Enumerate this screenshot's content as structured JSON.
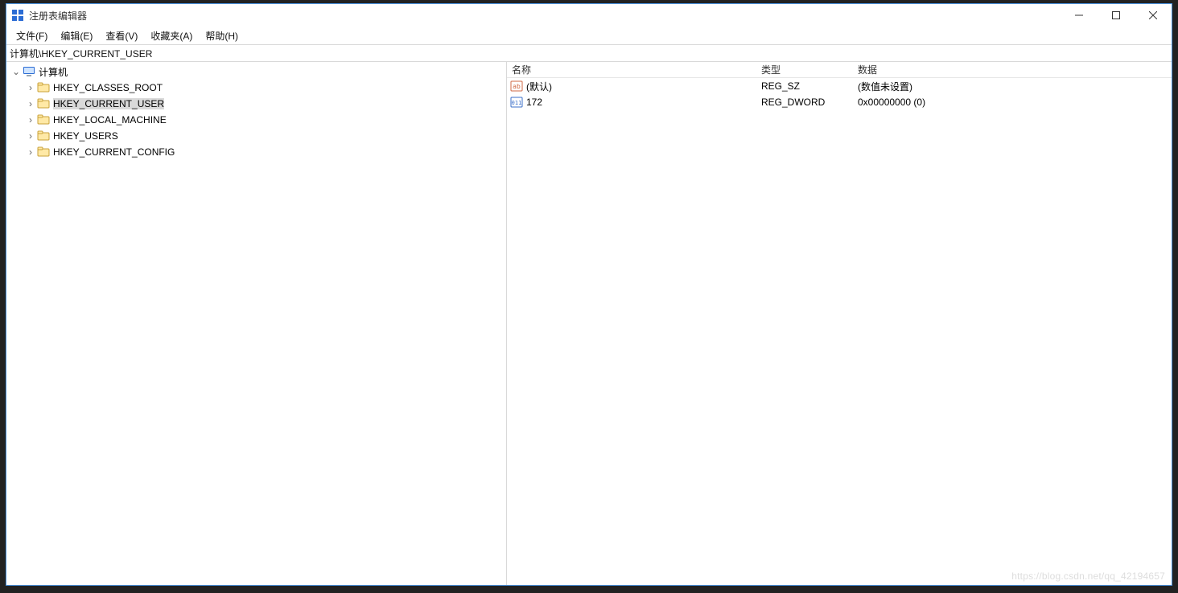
{
  "window": {
    "title": "注册表编辑器"
  },
  "menu": {
    "file": "文件(F)",
    "edit": "编辑(E)",
    "view": "查看(V)",
    "favorites": "收藏夹(A)",
    "help": "帮助(H)"
  },
  "address": {
    "path": "计算机\\HKEY_CURRENT_USER"
  },
  "tree": {
    "root": "计算机",
    "root_selected": false,
    "keys": [
      {
        "name": "HKEY_CLASSES_ROOT",
        "selected": false
      },
      {
        "name": "HKEY_CURRENT_USER",
        "selected": true
      },
      {
        "name": "HKEY_LOCAL_MACHINE",
        "selected": false
      },
      {
        "name": "HKEY_USERS",
        "selected": false
      },
      {
        "name": "HKEY_CURRENT_CONFIG",
        "selected": false
      }
    ]
  },
  "columns": {
    "name": "名称",
    "type": "类型",
    "data": "数据"
  },
  "values": [
    {
      "icon": "string",
      "name": "(默认)",
      "type": "REG_SZ",
      "data": "(数值未设置)"
    },
    {
      "icon": "binary",
      "name": "172",
      "type": "REG_DWORD",
      "data": "0x00000000 (0)"
    }
  ],
  "watermark": "https://blog.csdn.net/qq_42194657"
}
